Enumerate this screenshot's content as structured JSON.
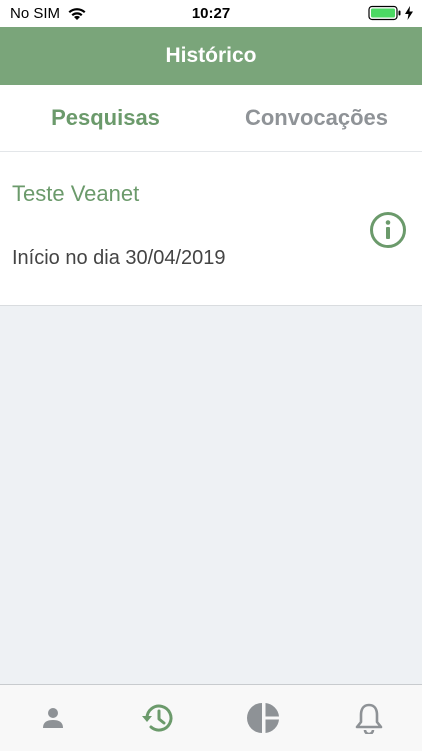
{
  "status": {
    "carrier": "No SIM",
    "time": "10:27"
  },
  "header": {
    "title": "Histórico"
  },
  "tabs": [
    {
      "label": "Pesquisas",
      "active": true
    },
    {
      "label": "Convocações",
      "active": false
    }
  ],
  "list": [
    {
      "title": "Teste Veanet",
      "subtitle": "Início no dia 30/04/2019",
      "icon": "info-icon"
    }
  ],
  "bottom_nav": [
    {
      "icon": "profile-icon",
      "active": false
    },
    {
      "icon": "history-icon",
      "active": true
    },
    {
      "icon": "pie-chart-icon",
      "active": false
    },
    {
      "icon": "bell-icon",
      "active": false
    }
  ],
  "colors": {
    "accent": "#7aa57a",
    "accent_text": "#6b9a6b",
    "inactive": "#8f9397"
  }
}
